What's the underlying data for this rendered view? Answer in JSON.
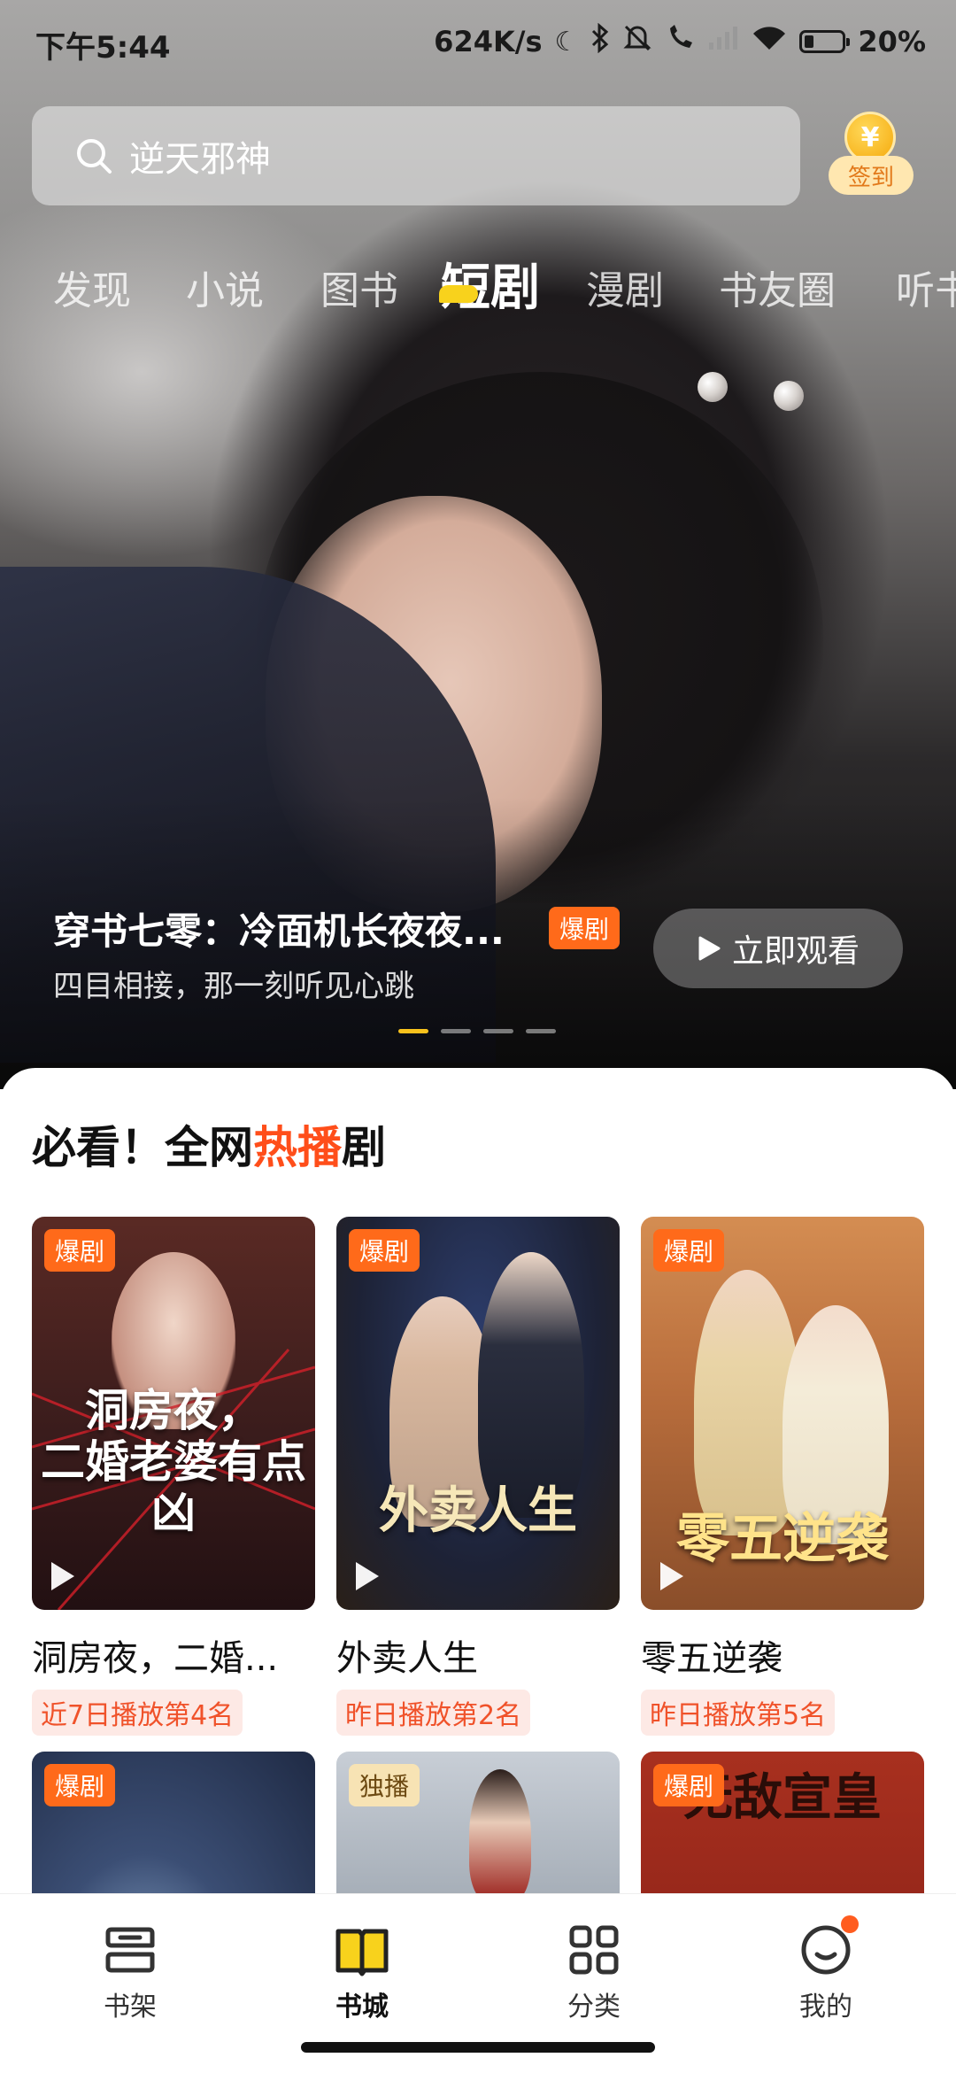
{
  "status_bar": {
    "time": "下午5:44",
    "net_speed": "624K/s",
    "battery": "20%",
    "icons": [
      "moon-icon",
      "bluetooth-icon",
      "mute-icon",
      "call-icon",
      "signal-icon",
      "wifi-icon",
      "battery-icon"
    ]
  },
  "search": {
    "placeholder": "逆天邪神"
  },
  "signin": {
    "coin": "¥",
    "label": "签到"
  },
  "tabs": [
    {
      "label": "发现"
    },
    {
      "label": "小说"
    },
    {
      "label": "图书"
    },
    {
      "label": "短剧",
      "active": true
    },
    {
      "label": "漫剧"
    },
    {
      "label": "书友圈"
    },
    {
      "label": "听书"
    }
  ],
  "hero": {
    "title": "穿书七零：冷面机长夜夜...",
    "tag": "爆剧",
    "subtitle": "四目相接，那一刻听见心跳",
    "watch_label": "立即观看",
    "carousel": {
      "count": 4,
      "active": 0
    }
  },
  "section": {
    "title_pre": "必看！全网",
    "title_hot": "热播",
    "title_post": "剧"
  },
  "dramas": [
    {
      "badge": "爆剧",
      "cover_text": "洞房夜，\n二婚老婆有点凶",
      "name": "洞房夜，二婚...",
      "rank": "近7日播放第4名",
      "cover_color": "#3a1c1c"
    },
    {
      "badge": "爆剧",
      "cover_text": "外卖人生",
      "name": "外卖人生",
      "rank": "昨日播放第2名",
      "cover_color": "#1d2236"
    },
    {
      "badge": "爆剧",
      "cover_text": "零五逆袭",
      "name": "零五逆袭",
      "rank": "昨日播放第5名",
      "cover_color": "#b86d3c"
    },
    {
      "badge": "爆剧",
      "cover_color": "#1f2a44"
    },
    {
      "badge": "独播",
      "cover_color": "#9aa3ad"
    },
    {
      "badge": "爆剧",
      "cover_text": "无敌宣皇",
      "cover_color": "#8e2318"
    }
  ],
  "bottom_nav": [
    {
      "label": "书架",
      "icon": "bookshelf-icon"
    },
    {
      "label": "书城",
      "icon": "book-open-icon",
      "active": true
    },
    {
      "label": "分类",
      "icon": "grid-icon"
    },
    {
      "label": "我的",
      "icon": "profile-icon",
      "has_dot": true
    }
  ]
}
